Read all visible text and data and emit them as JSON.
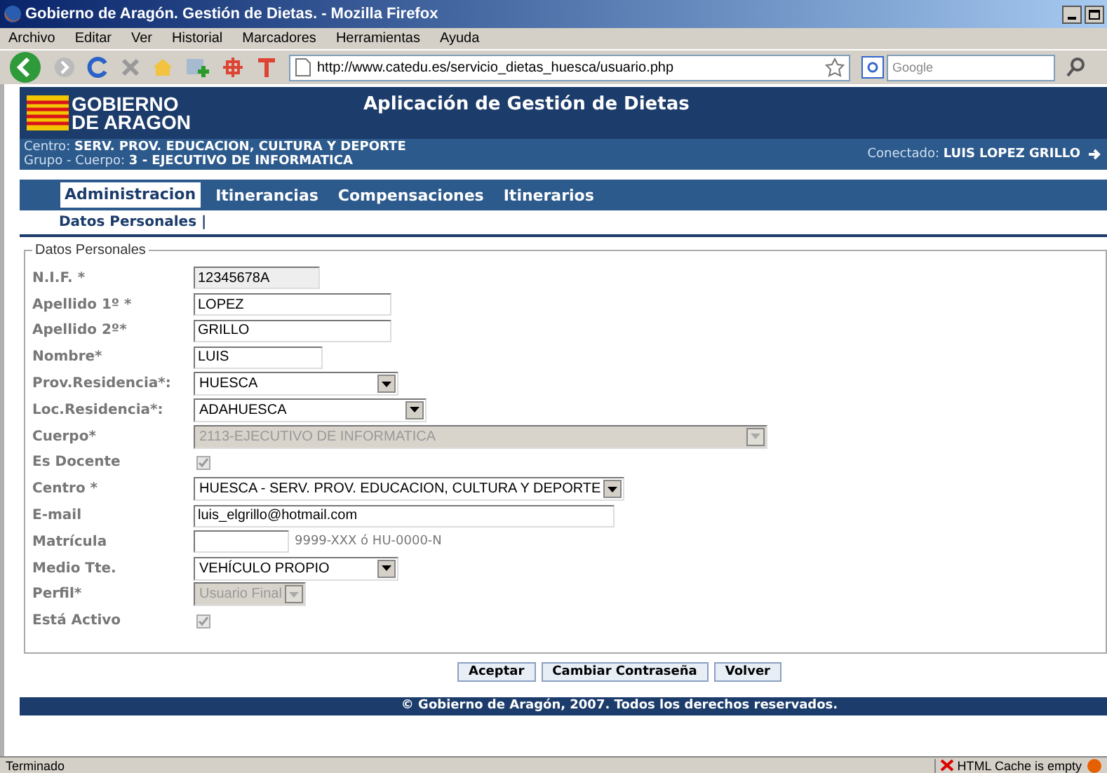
{
  "window": {
    "title": "Gobierno de Aragón. Gestión de Dietas. - Mozilla Firefox"
  },
  "menu": [
    "Archivo",
    "Editar",
    "Ver",
    "Historial",
    "Marcadores",
    "Herramientas",
    "Ayuda"
  ],
  "toolbar": {
    "url": "http://www.catedu.es/servicio_dietas_huesca/usuario.php",
    "search": {
      "placeholder": "Google"
    }
  },
  "header": {
    "logo": [
      "GOBIERNO",
      "DE ARAGON"
    ],
    "title": "Aplicación de Gestión de Dietas",
    "centro_label": "Centro:",
    "centro": "SERV. PROV. EDUCACION, CULTURA Y DEPORTE",
    "grupo_label": "Grupo - Cuerpo:",
    "grupo": "3 - EJECUTIVO DE INFORMATICA",
    "conectado_label": "Conectado:",
    "conectado": "LUIS LOPEZ GRILLO"
  },
  "tabs": [
    {
      "label": "Administracion",
      "selected": true
    },
    {
      "label": "Itinerancias",
      "selected": false
    },
    {
      "label": "Compensaciones",
      "selected": false
    },
    {
      "label": "Itinerarios",
      "selected": false
    }
  ],
  "subnav": "Datos Personales |",
  "fieldset": {
    "legend": "Datos Personales",
    "fields": [
      {
        "kind": "text",
        "label": "N.I.F. *",
        "value": "12345678A",
        "disabled": true
      },
      {
        "kind": "text",
        "label": "Apellido 1º *",
        "value": "LOPEZ",
        "disabled": false
      },
      {
        "kind": "text",
        "label": "Apellido 2º*",
        "value": "GRILLO",
        "disabled": false
      },
      {
        "kind": "text",
        "label": "Nombre*",
        "value": "LUIS",
        "disabled": false
      },
      {
        "kind": "select",
        "label": "Prov.Residencia*:",
        "value": "HUESCA",
        "disabled": false
      },
      {
        "kind": "select",
        "label": "Loc.Residencia*:",
        "value": "ADAHUESCA",
        "disabled": false
      },
      {
        "kind": "select",
        "label": "Cuerpo*",
        "value": "2113-EJECUTIVO DE INFORMATICA",
        "disabled": true
      },
      {
        "kind": "checkbox",
        "label": "Es Docente",
        "checked": true,
        "disabled": true
      },
      {
        "kind": "select",
        "label": "Centro *",
        "value": "HUESCA - SERV. PROV. EDUCACION, CULTURA Y DEPORTE",
        "disabled": false
      },
      {
        "kind": "text",
        "label": "E-mail",
        "value": "luis_elgrillo@hotmail.com",
        "disabled": false
      },
      {
        "kind": "text",
        "label": "Matrícula",
        "hint": "9999-XXX ó HU-0000-N",
        "disabled": false
      },
      {
        "kind": "select",
        "label": "Medio Tte.",
        "value": "VEHÍCULO PROPIO",
        "disabled": false
      },
      {
        "kind": "select",
        "label": "Perfil*",
        "value": "Usuario Final",
        "disabled": true
      },
      {
        "kind": "checkbox",
        "label": "Está Activo",
        "checked": true,
        "disabled": true
      }
    ]
  },
  "buttons": [
    "Aceptar",
    "Cambiar Contraseña",
    "Volver"
  ],
  "footer": "© Gobierno de Aragón, 2007. Todos los derechos reservados.",
  "status_bar": {
    "text": "Terminado",
    "cache": "HTML Cache is empty"
  }
}
